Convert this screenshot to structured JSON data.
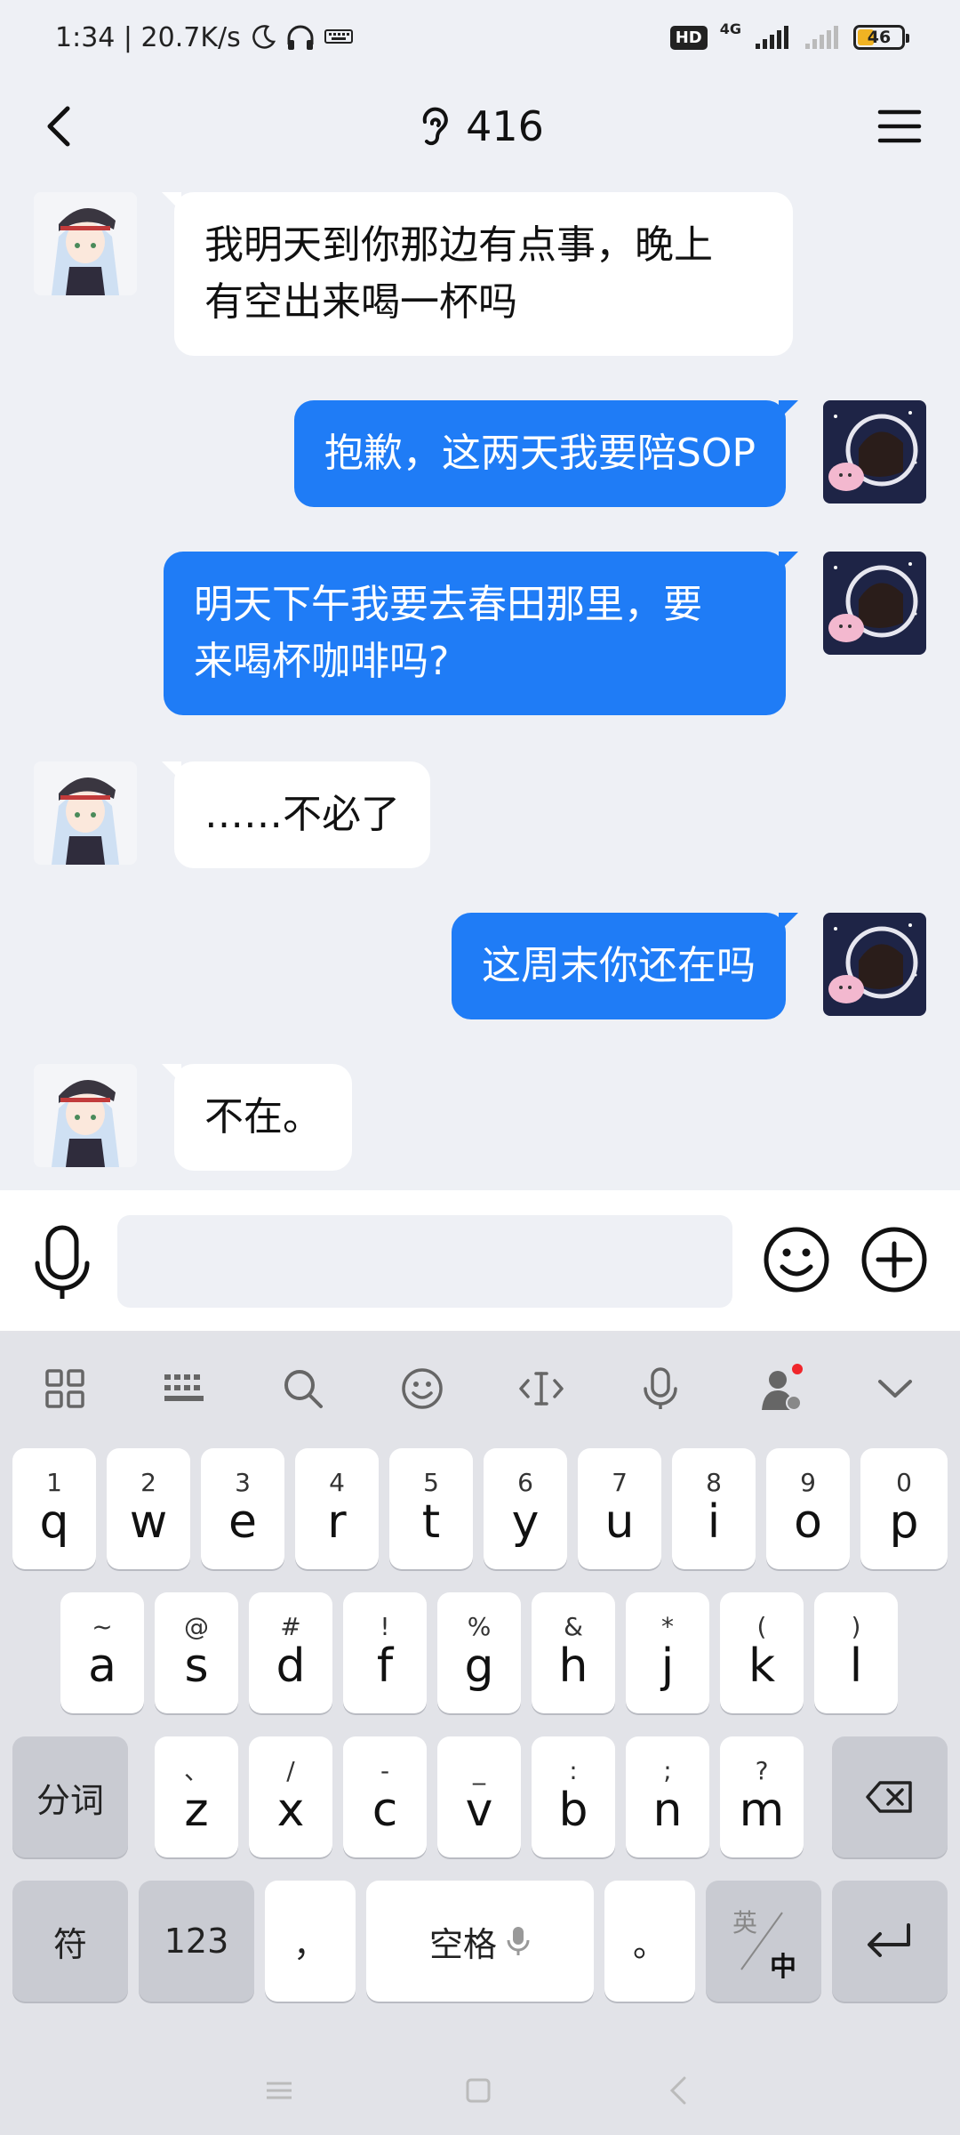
{
  "status": {
    "time_speed": "1:34 | 20.7K/s",
    "hd": "HD",
    "network": "4G",
    "battery": "46"
  },
  "header": {
    "title": "416"
  },
  "messages": [
    {
      "side": "in",
      "text": "我明天到你那边有点事，晚上\n有空出来喝一杯吗"
    },
    {
      "side": "out",
      "text": "抱歉，这两天我要陪SOP"
    },
    {
      "side": "out",
      "text": "明天下午我要去春田那里，要\n来喝杯咖啡吗?"
    },
    {
      "side": "in",
      "text": "……不必了"
    },
    {
      "side": "out",
      "text": "这周末你还在吗"
    },
    {
      "side": "in",
      "text": "不在。"
    }
  ],
  "input": {
    "value": "",
    "placeholder": ""
  },
  "keyboard": {
    "row1": [
      {
        "sub": "1",
        "main": "q"
      },
      {
        "sub": "2",
        "main": "w"
      },
      {
        "sub": "3",
        "main": "e"
      },
      {
        "sub": "4",
        "main": "r"
      },
      {
        "sub": "5",
        "main": "t"
      },
      {
        "sub": "6",
        "main": "y"
      },
      {
        "sub": "7",
        "main": "u"
      },
      {
        "sub": "8",
        "main": "i"
      },
      {
        "sub": "9",
        "main": "o"
      },
      {
        "sub": "0",
        "main": "p"
      }
    ],
    "row2": [
      {
        "sub": "~",
        "main": "a"
      },
      {
        "sub": "@",
        "main": "s"
      },
      {
        "sub": "#",
        "main": "d"
      },
      {
        "sub": "!",
        "main": "f"
      },
      {
        "sub": "%",
        "main": "g"
      },
      {
        "sub": "&",
        "main": "h"
      },
      {
        "sub": "*",
        "main": "j"
      },
      {
        "sub": "(",
        "main": "k"
      },
      {
        "sub": ")",
        "main": "l"
      }
    ],
    "row3": [
      {
        "sub": "、",
        "main": "z"
      },
      {
        "sub": "/",
        "main": "x"
      },
      {
        "sub": "-",
        "main": "c"
      },
      {
        "sub": "_",
        "main": "v"
      },
      {
        "sub": ":",
        "main": "b"
      },
      {
        "sub": ";",
        "main": "n"
      },
      {
        "sub": "?",
        "main": "m"
      }
    ],
    "segment_key": "分词",
    "symbol_key": "符",
    "num_key": "123",
    "comma_key": "，",
    "space_key": "空格",
    "period_key": "。",
    "lang_top": "英",
    "lang_bottom": "中"
  },
  "colors": {
    "accent": "#1f7cf6",
    "background": "#eef0f5",
    "notification_dot": "#f0262b"
  }
}
